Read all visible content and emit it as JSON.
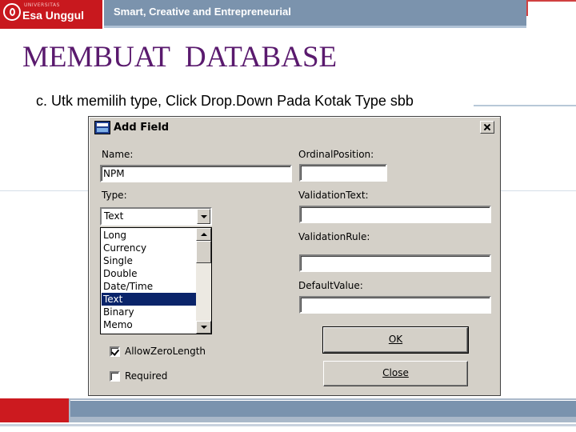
{
  "slide": {
    "brand_small": "UNIVERSITAS",
    "brand_name": "Esa Unggul",
    "tagline": "Smart, Creative and Entrepreneurial",
    "title": "MEMBUAT  DATABASE",
    "subtitle": "c. Utk memilih type, Click Drop.Down Pada Kotak Type sbb"
  },
  "dialog": {
    "title": "Add Field",
    "name_label": "Name:",
    "name_value": "NPM",
    "type_label": "Type:",
    "type_value": "Text",
    "type_options": [
      "Long",
      "Currency",
      "Single",
      "Double",
      "Date/Time",
      "Text",
      "Binary",
      "Memo"
    ],
    "selected_option": "Text",
    "ordinal_label": "OrdinalPosition:",
    "ordinal_value": "",
    "validation_text_label": "ValidationText:",
    "validation_text_value": "",
    "validation_rule_label": "ValidationRule:",
    "validation_rule_value": "",
    "default_value_label": "DefaultValue:",
    "default_value_value": "",
    "allow_zero_length_label": "AllowZeroLength",
    "allow_zero_length_checked": true,
    "required_label": "Required",
    "required_checked": false,
    "ok_label": "OK",
    "close_label": "Close"
  },
  "colors": {
    "brand_red": "#c8181e",
    "header_blue": "#7b93ad",
    "title_purple": "#5a1a6e",
    "selection": "#0a246a",
    "dialog_face": "#d4d0c8"
  }
}
